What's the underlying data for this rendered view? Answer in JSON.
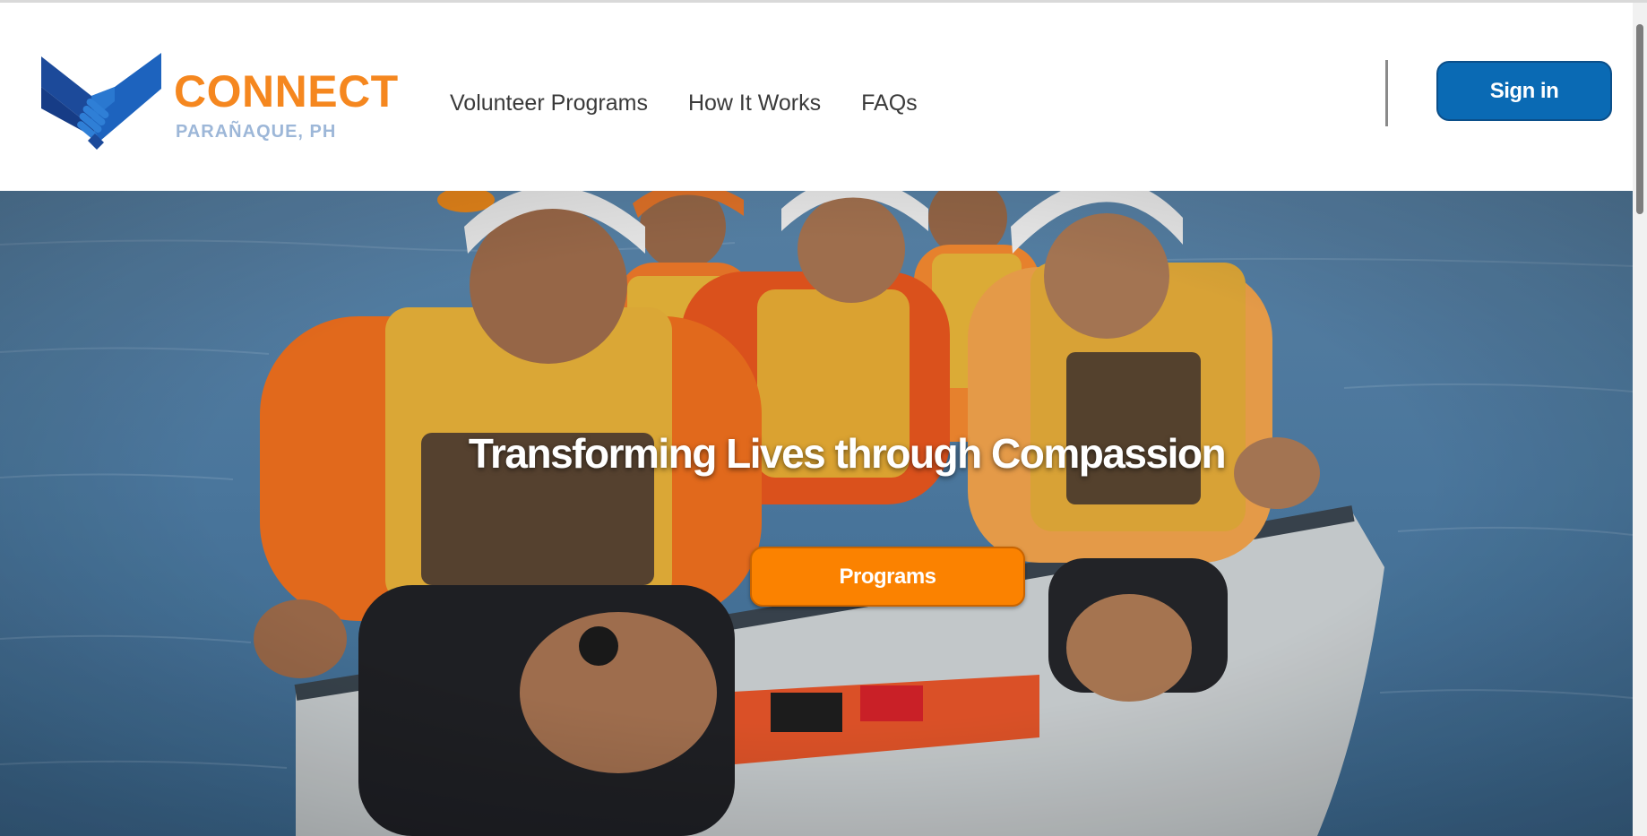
{
  "brand": {
    "name": "CONNECT",
    "location": "PARAÑAQUE, PH",
    "logo_icon": "handshake-check-icon",
    "colors": {
      "orange": "#f5871f",
      "blue": "#0a6ab4",
      "light_blue": "#9db7d8"
    }
  },
  "nav": {
    "items": [
      {
        "label": "Volunteer Programs"
      },
      {
        "label": "How It Works"
      },
      {
        "label": "FAQs"
      }
    ]
  },
  "header": {
    "signin_label": "Sign in"
  },
  "hero": {
    "title": "Transforming Lives through Compassion",
    "cta_label": "Programs",
    "cta_color": "#fb8200"
  }
}
